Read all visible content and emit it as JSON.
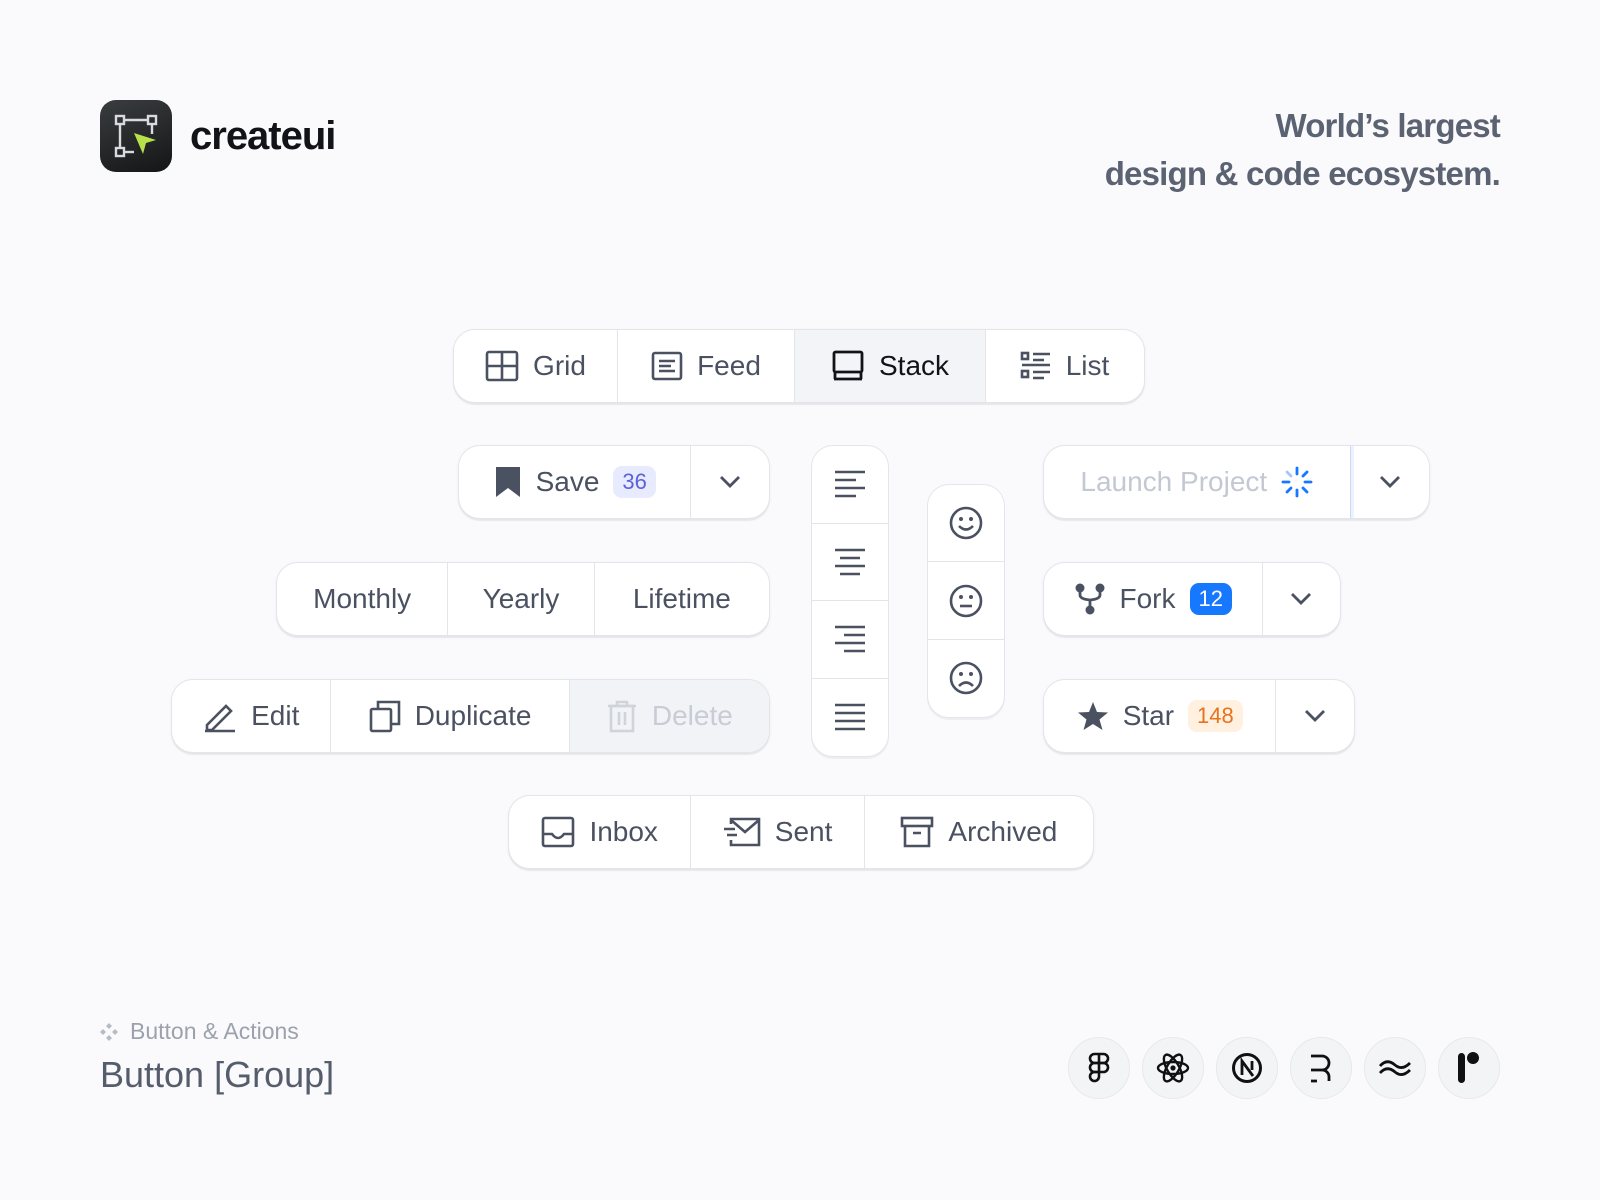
{
  "brand": {
    "name": "createui",
    "logo_icon": "selection-cursor-icon"
  },
  "tagline": {
    "line1": "World’s largest",
    "line2": "design & code ecosystem."
  },
  "view_group": {
    "items": [
      {
        "label": "Grid",
        "icon": "grid-icon"
      },
      {
        "label": "Feed",
        "icon": "feed-icon"
      },
      {
        "label": "Stack",
        "icon": "stack-icon",
        "selected": true
      },
      {
        "label": "List",
        "icon": "list-icon"
      }
    ]
  },
  "save_group": {
    "label": "Save",
    "count": "36",
    "icon": "bookmark-icon"
  },
  "billing_group": {
    "items": [
      "Monthly",
      "Yearly",
      "Lifetime"
    ]
  },
  "edit_group": {
    "edit": "Edit",
    "duplicate": "Duplicate",
    "delete": "Delete",
    "delete_disabled": true
  },
  "mail_group": {
    "inbox": "Inbox",
    "sent": "Sent",
    "archived": "Archived"
  },
  "align_group": {
    "items": [
      "align-left-icon",
      "align-center-icon",
      "align-right-icon",
      "align-justify-icon"
    ]
  },
  "mood_group": {
    "items": [
      "smile-icon",
      "neutral-face-icon",
      "frown-icon"
    ]
  },
  "launch_group": {
    "label": "Launch Project",
    "state": "loading"
  },
  "fork_group": {
    "label": "Fork",
    "count": "12"
  },
  "star_group": {
    "label": "Star",
    "count": "148"
  },
  "footer": {
    "category": "Button & Actions",
    "title": "Button [Group]",
    "tech_icons": [
      "figma-icon",
      "react-icon",
      "nextjs-icon",
      "remix-icon",
      "tailwind-icon",
      "framer-icon"
    ]
  },
  "colors": {
    "background": "#fafafc",
    "text": "#4a5161",
    "border": "#e3e5ea",
    "fork_badge": "#1677ff",
    "star_badge_text": "#e7731f",
    "save_badge_text": "#5b62d9",
    "launch_border": "#c7dafb"
  }
}
